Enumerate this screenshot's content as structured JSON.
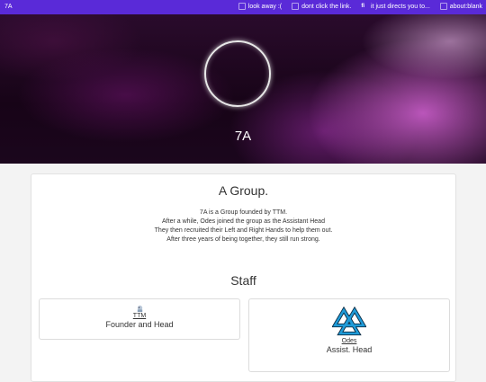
{
  "nav": {
    "brand": "7A",
    "links": [
      {
        "label": "look away :(",
        "icon": "image-icon"
      },
      {
        "label": "dont click the link.",
        "icon": "image-icon"
      },
      {
        "label": "it just directs you to...",
        "icon": "text-icon",
        "glyph": "fi"
      },
      {
        "label": "about:blank",
        "icon": "image-icon"
      }
    ],
    "bar_color": "#5a2ad8"
  },
  "hero": {
    "title": "7A"
  },
  "about": {
    "title": "A Group.",
    "lines": [
      "7A is a Group founded by TTM.",
      "After a while, Odes joined the group as the Assistant Head",
      "They then recruited their Left and Right Hands to help them out.",
      "After three years of being together, they still run strong."
    ]
  },
  "staff": {
    "title": "Staff",
    "members": [
      {
        "name": "TTM",
        "role": "Founder and Head",
        "icon": "small-avatar-icon"
      },
      {
        "name": "Odes",
        "role": "Assist. Head",
        "icon": "valknut-logo-icon",
        "logo_color": "#1f9bd8"
      }
    ]
  }
}
